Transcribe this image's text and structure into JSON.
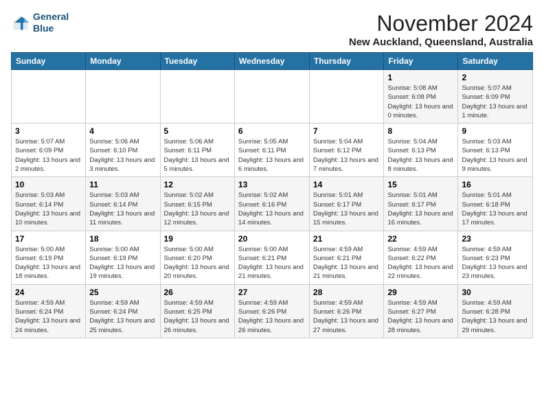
{
  "header": {
    "logo_line1": "General",
    "logo_line2": "Blue",
    "month": "November 2024",
    "location": "New Auckland, Queensland, Australia"
  },
  "weekdays": [
    "Sunday",
    "Monday",
    "Tuesday",
    "Wednesday",
    "Thursday",
    "Friday",
    "Saturday"
  ],
  "weeks": [
    [
      {
        "day": "",
        "info": ""
      },
      {
        "day": "",
        "info": ""
      },
      {
        "day": "",
        "info": ""
      },
      {
        "day": "",
        "info": ""
      },
      {
        "day": "",
        "info": ""
      },
      {
        "day": "1",
        "info": "Sunrise: 5:08 AM\nSunset: 6:08 PM\nDaylight: 13 hours and 0 minutes."
      },
      {
        "day": "2",
        "info": "Sunrise: 5:07 AM\nSunset: 6:09 PM\nDaylight: 13 hours and 1 minute."
      }
    ],
    [
      {
        "day": "3",
        "info": "Sunrise: 5:07 AM\nSunset: 6:09 PM\nDaylight: 13 hours and 2 minutes."
      },
      {
        "day": "4",
        "info": "Sunrise: 5:06 AM\nSunset: 6:10 PM\nDaylight: 13 hours and 3 minutes."
      },
      {
        "day": "5",
        "info": "Sunrise: 5:06 AM\nSunset: 6:11 PM\nDaylight: 13 hours and 5 minutes."
      },
      {
        "day": "6",
        "info": "Sunrise: 5:05 AM\nSunset: 6:11 PM\nDaylight: 13 hours and 6 minutes."
      },
      {
        "day": "7",
        "info": "Sunrise: 5:04 AM\nSunset: 6:12 PM\nDaylight: 13 hours and 7 minutes."
      },
      {
        "day": "8",
        "info": "Sunrise: 5:04 AM\nSunset: 6:13 PM\nDaylight: 13 hours and 8 minutes."
      },
      {
        "day": "9",
        "info": "Sunrise: 5:03 AM\nSunset: 6:13 PM\nDaylight: 13 hours and 9 minutes."
      }
    ],
    [
      {
        "day": "10",
        "info": "Sunrise: 5:03 AM\nSunset: 6:14 PM\nDaylight: 13 hours and 10 minutes."
      },
      {
        "day": "11",
        "info": "Sunrise: 5:03 AM\nSunset: 6:14 PM\nDaylight: 13 hours and 11 minutes."
      },
      {
        "day": "12",
        "info": "Sunrise: 5:02 AM\nSunset: 6:15 PM\nDaylight: 13 hours and 12 minutes."
      },
      {
        "day": "13",
        "info": "Sunrise: 5:02 AM\nSunset: 6:16 PM\nDaylight: 13 hours and 14 minutes."
      },
      {
        "day": "14",
        "info": "Sunrise: 5:01 AM\nSunset: 6:17 PM\nDaylight: 13 hours and 15 minutes."
      },
      {
        "day": "15",
        "info": "Sunrise: 5:01 AM\nSunset: 6:17 PM\nDaylight: 13 hours and 16 minutes."
      },
      {
        "day": "16",
        "info": "Sunrise: 5:01 AM\nSunset: 6:18 PM\nDaylight: 13 hours and 17 minutes."
      }
    ],
    [
      {
        "day": "17",
        "info": "Sunrise: 5:00 AM\nSunset: 6:19 PM\nDaylight: 13 hours and 18 minutes."
      },
      {
        "day": "18",
        "info": "Sunrise: 5:00 AM\nSunset: 6:19 PM\nDaylight: 13 hours and 19 minutes."
      },
      {
        "day": "19",
        "info": "Sunrise: 5:00 AM\nSunset: 6:20 PM\nDaylight: 13 hours and 20 minutes."
      },
      {
        "day": "20",
        "info": "Sunrise: 5:00 AM\nSunset: 6:21 PM\nDaylight: 13 hours and 21 minutes."
      },
      {
        "day": "21",
        "info": "Sunrise: 4:59 AM\nSunset: 6:21 PM\nDaylight: 13 hours and 21 minutes."
      },
      {
        "day": "22",
        "info": "Sunrise: 4:59 AM\nSunset: 6:22 PM\nDaylight: 13 hours and 22 minutes."
      },
      {
        "day": "23",
        "info": "Sunrise: 4:59 AM\nSunset: 6:23 PM\nDaylight: 13 hours and 23 minutes."
      }
    ],
    [
      {
        "day": "24",
        "info": "Sunrise: 4:59 AM\nSunset: 6:24 PM\nDaylight: 13 hours and 24 minutes."
      },
      {
        "day": "25",
        "info": "Sunrise: 4:59 AM\nSunset: 6:24 PM\nDaylight: 13 hours and 25 minutes."
      },
      {
        "day": "26",
        "info": "Sunrise: 4:59 AM\nSunset: 6:25 PM\nDaylight: 13 hours and 26 minutes."
      },
      {
        "day": "27",
        "info": "Sunrise: 4:59 AM\nSunset: 6:26 PM\nDaylight: 13 hours and 26 minutes."
      },
      {
        "day": "28",
        "info": "Sunrise: 4:59 AM\nSunset: 6:26 PM\nDaylight: 13 hours and 27 minutes."
      },
      {
        "day": "29",
        "info": "Sunrise: 4:59 AM\nSunset: 6:27 PM\nDaylight: 13 hours and 28 minutes."
      },
      {
        "day": "30",
        "info": "Sunrise: 4:59 AM\nSunset: 6:28 PM\nDaylight: 13 hours and 29 minutes."
      }
    ]
  ]
}
